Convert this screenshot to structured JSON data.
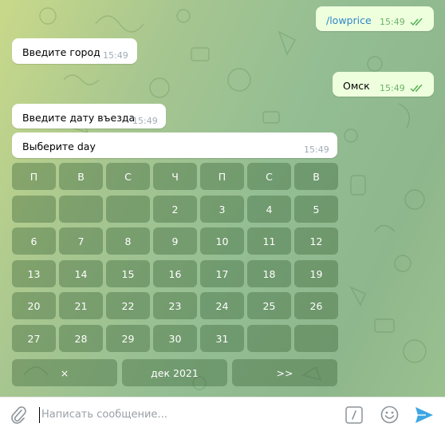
{
  "messages": [
    {
      "text": "/lowprice",
      "time": "15:49",
      "outgoing": true
    },
    {
      "text": "Введите город",
      "time": "15:49",
      "outgoing": false
    },
    {
      "text": "Омск",
      "time": "15:49",
      "outgoing": true
    },
    {
      "text": "Введите дату въезда",
      "time": "15:49",
      "outgoing": false
    },
    {
      "text": "Выберите day",
      "time": "15:49",
      "outgoing": false
    }
  ],
  "calendar": {
    "weekdays": [
      "П",
      "В",
      "С",
      "Ч",
      "П",
      "С",
      "В"
    ],
    "rows": [
      [
        "",
        "",
        "",
        "2",
        "3",
        "4",
        "5"
      ],
      [
        "6",
        "7",
        "8",
        "9",
        "10",
        "11",
        "12"
      ],
      [
        "13",
        "14",
        "15",
        "16",
        "17",
        "18",
        "19"
      ],
      [
        "20",
        "21",
        "22",
        "23",
        "24",
        "25",
        "26"
      ],
      [
        "27",
        "28",
        "29",
        "30",
        "31",
        "",
        ""
      ]
    ],
    "nav": {
      "prev": "×",
      "month": "дек 2021",
      "next": ">>"
    }
  },
  "composer": {
    "placeholder": "Написать сообщение..."
  },
  "icons": [
    "paperclip-icon",
    "commands-icon",
    "emoji-icon",
    "send-icon",
    "double-check-icon"
  ],
  "colors": {
    "accent": "#3ea7e3",
    "outgoing_bubble": "#eeffde",
    "read_checks": "#4fae4e"
  }
}
